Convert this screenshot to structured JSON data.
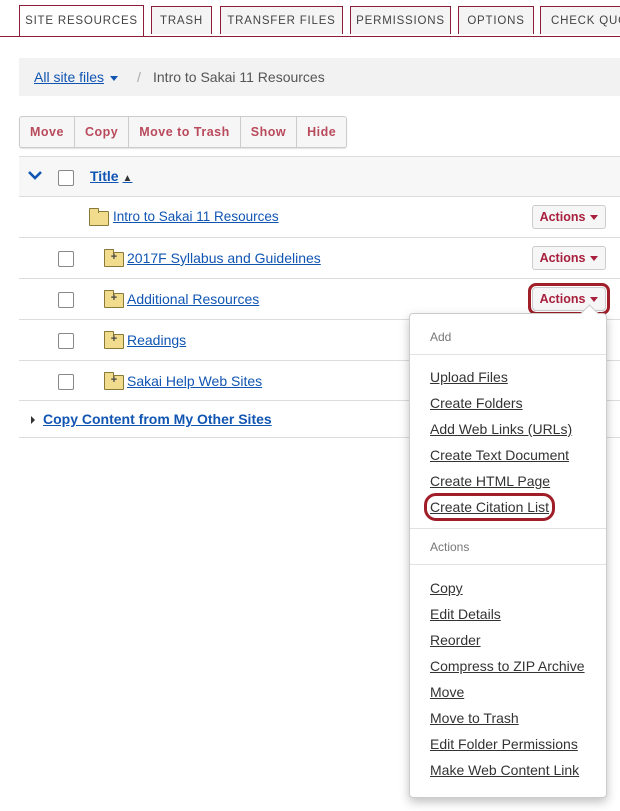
{
  "tabs": [
    "SITE RESOURCES",
    "TRASH",
    "TRANSFER FILES",
    "PERMISSIONS",
    "OPTIONS",
    "CHECK QUO"
  ],
  "breadcrumb": {
    "link": "All site files",
    "separator": "/",
    "current": "Intro to Sakai 11 Resources"
  },
  "toolbar": [
    "Move",
    "Copy",
    "Move to Trash",
    "Show",
    "Hide"
  ],
  "table": {
    "header_title": "Title",
    "sort_icon": "sort-ascending-icon",
    "rows": [
      {
        "name": "Intro to Sakai 11 Resources",
        "actions": "Actions"
      },
      {
        "name": "2017F Syllabus and Guidelines",
        "actions": "Actions"
      },
      {
        "name": "Additional Resources",
        "actions": "Actions"
      },
      {
        "name": "Readings",
        "actions": "Actions"
      },
      {
        "name": "Sakai Help Web Sites",
        "actions": "Actions"
      }
    ],
    "copy_content": "Copy Content from My Other Sites"
  },
  "menu": {
    "add_header": "Add",
    "add_items": [
      "Upload Files",
      "Create Folders",
      "Add Web Links (URLs)",
      "Create Text Document",
      "Create HTML Page",
      "Create Citation List"
    ],
    "actions_header": "Actions",
    "action_items": [
      "Copy",
      "Edit Details",
      "Reorder",
      "Compress to ZIP Archive",
      "Move",
      "Move to Trash",
      "Edit Folder Permissions",
      "Make Web Content Link"
    ]
  },
  "colors": {
    "accent": "#a8203d",
    "link": "#1155b3",
    "highlight": "#a01e28"
  }
}
